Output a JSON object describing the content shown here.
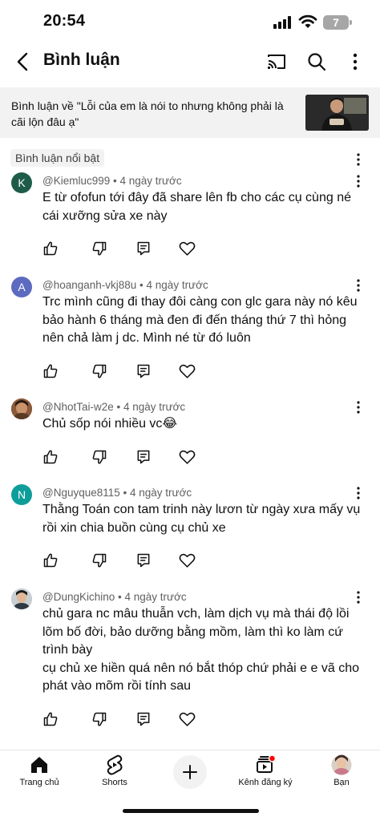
{
  "status_bar": {
    "time": "20:54",
    "battery_level": "7"
  },
  "header": {
    "title": "Bình luận"
  },
  "video": {
    "banner_text": "Bình luận về \"Lỗi của em là nói to nhưng không phải là cãi lộn đâu ạ\""
  },
  "section": {
    "featured_label": "Bình luận nổi bật"
  },
  "comments": [
    {
      "author": "@Kiemluc999",
      "time": "4 ngày trước",
      "text": "E từ ofofun tới đây đã share lên fb cho các cụ cùng né cái xưỡng sửa xe này",
      "avatar_letter": "K",
      "avatar_color": "#1e5c4a"
    },
    {
      "author": "@hoanganh-vkj88u",
      "time": "4 ngày trước",
      "text": "Trc mình cũng đi thay đôi càng con glc gara này nó kêu bảo hành 6 tháng mà đen đi đến tháng thứ 7 thì hỏng nên chả làm j dc. Mình né từ đó luôn",
      "avatar_letter": "A",
      "avatar_color": "#5c6bc0"
    },
    {
      "author": "@NhotTai-w2e",
      "time": "4 ngày trước",
      "text": "Chủ sốp nói nhiều vc😂",
      "avatar_letter": "",
      "avatar_color": "#7a4a2e"
    },
    {
      "author": "@Nguyque8115",
      "time": "4 ngày trước",
      "text": "Thằng Toán con tam trinh này lươn từ ngày xưa mấy vụ rồi xin chia buồn cùng cụ chủ xe",
      "avatar_letter": "N",
      "avatar_color": "#0f9d9a"
    },
    {
      "author": "@DungKichino",
      "time": "4 ngày trước",
      "text": "chủ gara nc mâu thuẫn vch, làm dịch vụ mà thái độ lồi lõm bố đời, bảo dưỡng bằng mồm, làm thì ko làm cứ trình bày\ncụ chủ xe hiền quá nên nó bắt thóp chứ phải e e vã cho phát vào mõm rồi tính sau",
      "avatar_letter": "",
      "avatar_color": "#9aa3a8"
    }
  ],
  "icons": {
    "like": "thumbs-up-icon",
    "dislike": "thumbs-down-icon",
    "reply": "reply-icon",
    "heart": "heart-icon",
    "cast": "cast-icon",
    "search": "search-icon",
    "more": "more-vertical-icon"
  },
  "bottom_nav": {
    "home": "Trang chủ",
    "shorts": "Shorts",
    "subscriptions": "Kênh đăng ký",
    "you": "Bạn"
  },
  "colors": {
    "accent_red": "#ff0000",
    "text_primary": "#0f0f0f",
    "text_secondary": "#606060"
  }
}
